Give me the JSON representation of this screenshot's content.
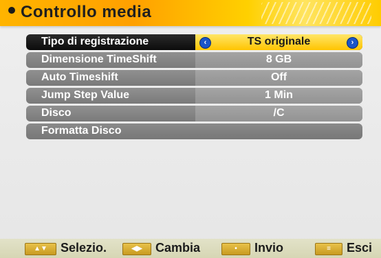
{
  "header": {
    "title": "Controllo media"
  },
  "menu": {
    "items": [
      {
        "label": "Tipo di registrazione",
        "value": "TS originale"
      },
      {
        "label": "Dimensione TimeShift",
        "value": "8 GB"
      },
      {
        "label": "Auto Timeshift",
        "value": "Off"
      },
      {
        "label": "Jump Step Value",
        "value": "1 Min"
      },
      {
        "label": "Disco",
        "value": "/C"
      },
      {
        "label": "Formatta Disco"
      }
    ],
    "selected_index": 0,
    "arrow_left_icon": "chevron-left-icon",
    "arrow_right_icon": "chevron-right-icon"
  },
  "footer": {
    "select": {
      "key_icon": "up-down-arrows-icon",
      "label": "Selezio."
    },
    "change": {
      "key_icon": "left-right-arrows-icon",
      "label": "Cambia"
    },
    "enter": {
      "key_icon": "ok-key-icon",
      "label": "Invio"
    },
    "exit": {
      "key_icon": "menu-key-icon",
      "label": "Esci"
    }
  },
  "colors": {
    "header_accent": "#ffb400",
    "selected_value_bg": "#ffd43a",
    "row_bg": "#8a8a8a",
    "arrow_blue": "#1a55c9"
  }
}
